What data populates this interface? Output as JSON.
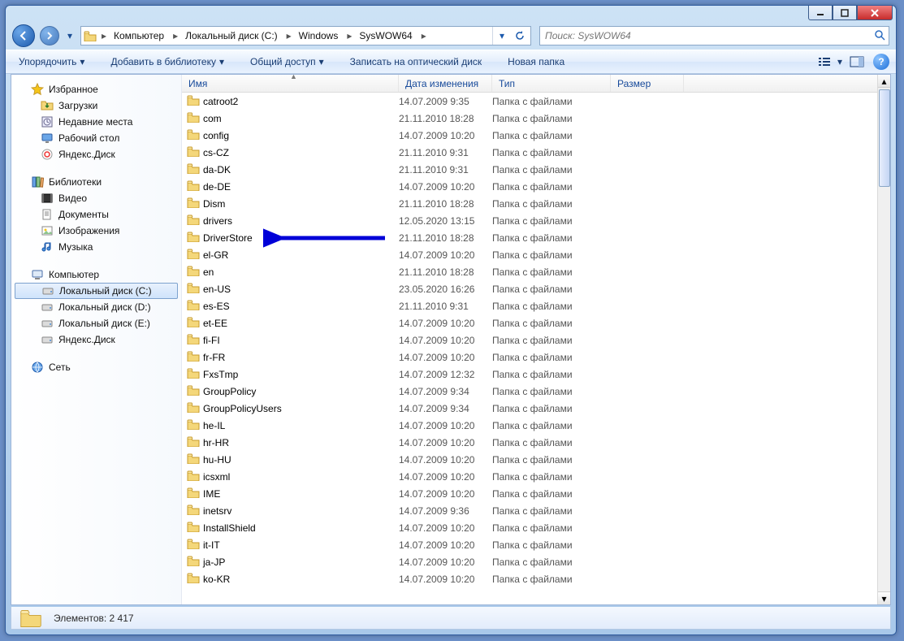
{
  "breadcrumb": {
    "items": [
      "Компьютер",
      "Локальный диск (C:)",
      "Windows",
      "SysWOW64"
    ]
  },
  "search": {
    "placeholder": "Поиск: SysWOW64"
  },
  "toolbar": {
    "organize": "Упорядочить",
    "library": "Добавить в библиотеку",
    "share": "Общий доступ",
    "burn": "Записать на оптический диск",
    "new_folder": "Новая папка"
  },
  "columns": {
    "name": "Имя",
    "date": "Дата изменения",
    "type": "Тип",
    "size": "Размер"
  },
  "sidebar": {
    "favorites": {
      "label": "Избранное",
      "items": [
        {
          "label": "Загрузки",
          "icon": "downloads-icon"
        },
        {
          "label": "Недавние места",
          "icon": "recent-icon"
        },
        {
          "label": "Рабочий стол",
          "icon": "desktop-icon"
        },
        {
          "label": "Яндекс.Диск",
          "icon": "yandex-icon"
        }
      ]
    },
    "libraries": {
      "label": "Библиотеки",
      "items": [
        {
          "label": "Видео",
          "icon": "video-icon"
        },
        {
          "label": "Документы",
          "icon": "documents-icon"
        },
        {
          "label": "Изображения",
          "icon": "pictures-icon"
        },
        {
          "label": "Музыка",
          "icon": "music-icon"
        }
      ]
    },
    "computer": {
      "label": "Компьютер",
      "items": [
        {
          "label": "Локальный диск (C:)",
          "selected": true
        },
        {
          "label": "Локальный диск (D:)"
        },
        {
          "label": "Локальный диск (E:)"
        },
        {
          "label": "Яндекс.Диск"
        }
      ]
    },
    "network": {
      "label": "Сеть"
    }
  },
  "folder_type": "Папка с файлами",
  "files": [
    {
      "name": "catroot2",
      "date": "14.07.2009 9:35"
    },
    {
      "name": "com",
      "date": "21.11.2010 18:28"
    },
    {
      "name": "config",
      "date": "14.07.2009 10:20"
    },
    {
      "name": "cs-CZ",
      "date": "21.11.2010 9:31"
    },
    {
      "name": "da-DK",
      "date": "21.11.2010 9:31"
    },
    {
      "name": "de-DE",
      "date": "14.07.2009 10:20"
    },
    {
      "name": "Dism",
      "date": "21.11.2010 18:28"
    },
    {
      "name": "drivers",
      "date": "12.05.2020 13:15"
    },
    {
      "name": "DriverStore",
      "date": "21.11.2010 18:28"
    },
    {
      "name": "el-GR",
      "date": "14.07.2009 10:20"
    },
    {
      "name": "en",
      "date": "21.11.2010 18:28"
    },
    {
      "name": "en-US",
      "date": "23.05.2020 16:26"
    },
    {
      "name": "es-ES",
      "date": "21.11.2010 9:31"
    },
    {
      "name": "et-EE",
      "date": "14.07.2009 10:20"
    },
    {
      "name": "fi-FI",
      "date": "14.07.2009 10:20"
    },
    {
      "name": "fr-FR",
      "date": "14.07.2009 10:20"
    },
    {
      "name": "FxsTmp",
      "date": "14.07.2009 12:32"
    },
    {
      "name": "GroupPolicy",
      "date": "14.07.2009 9:34"
    },
    {
      "name": "GroupPolicyUsers",
      "date": "14.07.2009 9:34"
    },
    {
      "name": "he-IL",
      "date": "14.07.2009 10:20"
    },
    {
      "name": "hr-HR",
      "date": "14.07.2009 10:20"
    },
    {
      "name": "hu-HU",
      "date": "14.07.2009 10:20"
    },
    {
      "name": "icsxml",
      "date": "14.07.2009 10:20"
    },
    {
      "name": "IME",
      "date": "14.07.2009 10:20"
    },
    {
      "name": "inetsrv",
      "date": "14.07.2009 9:36"
    },
    {
      "name": "InstallShield",
      "date": "14.07.2009 10:20"
    },
    {
      "name": "it-IT",
      "date": "14.07.2009 10:20"
    },
    {
      "name": "ja-JP",
      "date": "14.07.2009 10:20"
    },
    {
      "name": "ko-KR",
      "date": "14.07.2009 10:20"
    }
  ],
  "status": {
    "text": "Элементов: 2 417"
  },
  "annotation": {
    "target_row": 8
  }
}
